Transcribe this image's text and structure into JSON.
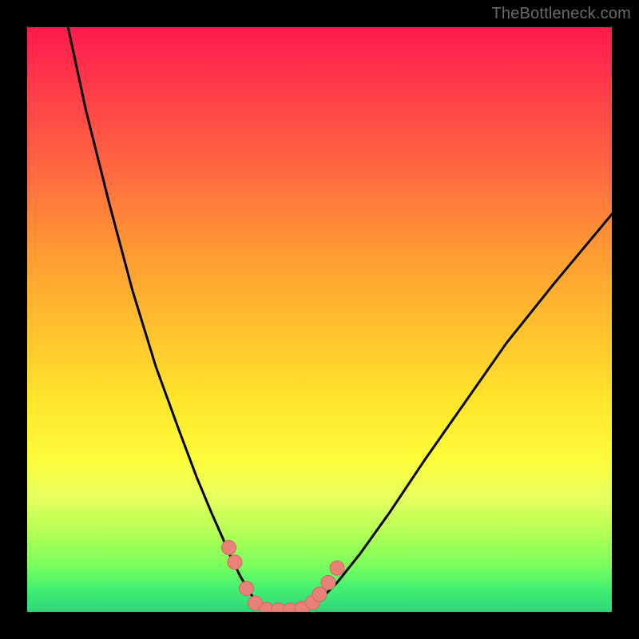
{
  "attribution": "TheBottleneck.com",
  "colors": {
    "frame": "#000000",
    "curve": "#000000",
    "marker_fill": "#e88177",
    "marker_stroke": "#cc6a60"
  },
  "chart_data": {
    "type": "line",
    "title": "",
    "xlabel": "",
    "ylabel": "",
    "xlim": [
      0,
      100
    ],
    "ylim": [
      0,
      100
    ],
    "grid": false,
    "series": [
      {
        "name": "left-branch",
        "x": [
          7,
          10,
          14,
          18,
          22,
          26,
          29,
          31.5,
          33.5,
          35,
          36.5,
          38,
          39.2,
          40
        ],
        "y": [
          100,
          86,
          70,
          55,
          42,
          31,
          23,
          17,
          12.5,
          9,
          6,
          3.5,
          1.5,
          0.5
        ]
      },
      {
        "name": "valley",
        "x": [
          40,
          41,
          42,
          43,
          44,
          45,
          46,
          47,
          48
        ],
        "y": [
          0.5,
          0.2,
          0.1,
          0.1,
          0.1,
          0.1,
          0.2,
          0.4,
          0.8
        ]
      },
      {
        "name": "right-branch",
        "x": [
          48,
          50,
          53,
          57,
          62,
          68,
          75,
          82,
          90,
          100
        ],
        "y": [
          0.8,
          2,
          5,
          10,
          17,
          26,
          36,
          46,
          56,
          68
        ]
      }
    ],
    "markers": [
      {
        "x": 34.5,
        "y": 11
      },
      {
        "x": 35.5,
        "y": 8.5
      },
      {
        "x": 37.5,
        "y": 4
      },
      {
        "x": 39,
        "y": 1.5
      },
      {
        "x": 41,
        "y": 0.4
      },
      {
        "x": 43,
        "y": 0.3
      },
      {
        "x": 45,
        "y": 0.3
      },
      {
        "x": 47,
        "y": 0.6
      },
      {
        "x": 48.8,
        "y": 1.6
      },
      {
        "x": 50,
        "y": 3
      },
      {
        "x": 51.5,
        "y": 5
      },
      {
        "x": 53,
        "y": 7.5
      }
    ]
  }
}
